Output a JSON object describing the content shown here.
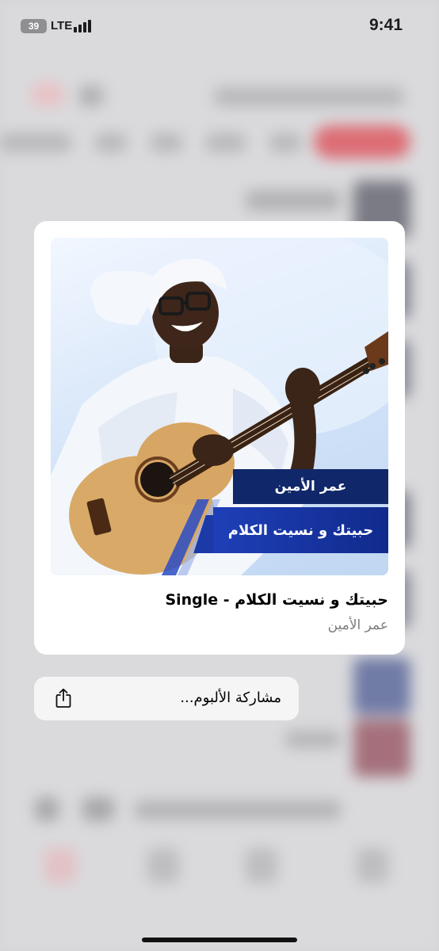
{
  "status_bar": {
    "battery": "39",
    "network": "LTE",
    "signal_bars": 4,
    "time": "9:41"
  },
  "preview": {
    "artwork": {
      "artist_banner": "عمر الأمين",
      "title_banner": "حبيتك و نسيت الكلام"
    },
    "title": "حبيتك و نسيت الكلام - Single",
    "artist": "عمر الأمين"
  },
  "actions": {
    "share_label": "مشاركة الألبوم...",
    "share_icon": "share-icon"
  },
  "colors": {
    "accent_red": "#e0343f",
    "banner_navy": "#10276a",
    "banner_blue": "#1f3fb8"
  }
}
